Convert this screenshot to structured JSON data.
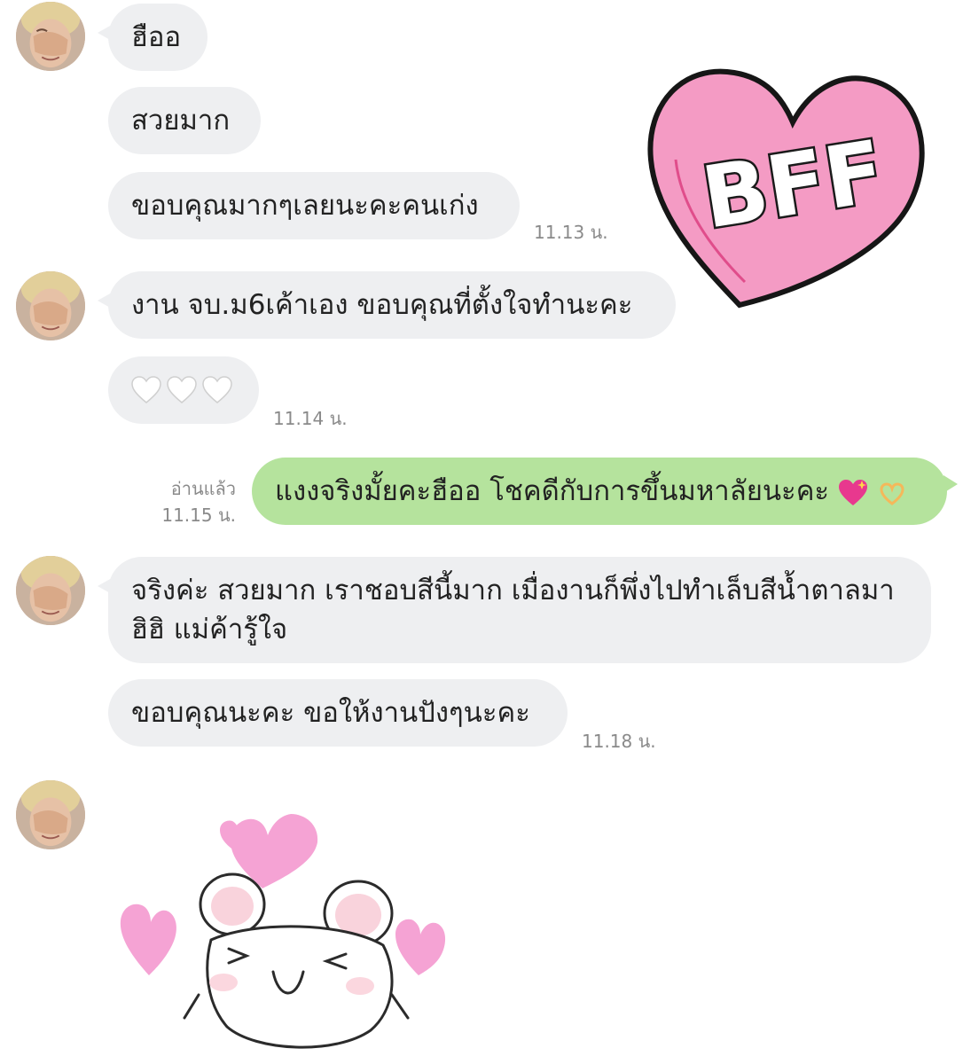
{
  "colors": {
    "received_bubble": "#eeeff1",
    "sent_bubble": "#b5e39d",
    "timestamp": "#8a8a8a",
    "sticker_pink": "#f07ab0",
    "text": "#222222"
  },
  "bff_sticker": {
    "text": "BFF",
    "icon": "pink-heart-bff-sticker"
  },
  "messages": [
    {
      "text": "ฮืออ"
    },
    {
      "text": "สวยมาก"
    },
    {
      "text": "ขอบคุณมากๆเลยนะคะคนเก่ง",
      "time": "11.13 น."
    },
    {
      "text": "งาน จบ.ม6เค้าเอง ขอบคุณที่ตั้งใจทำนะคะ"
    },
    {
      "icon": "white-heart-emoji",
      "count": 3,
      "time": "11.14 น."
    },
    {
      "text": "แงงจริงมั้ยคะฮืออ โชคดีกับการขึ้นมหาลัยนะคะ",
      "trailing_icons": [
        "sparkling-heart-emoji",
        "heart-hands-emoji"
      ],
      "read": "อ่านแล้ว",
      "time": "11.15 น."
    },
    {
      "text": "จริงค่ะ สวยมาก เราชอบสีนี้มาก เมื่องานก็พึ่งไปทำเล็บสีน้ำตาลมา ฮิฮิ แม่ค้ารู้ใจ"
    },
    {
      "text": "ขอบคุณนะคะ ขอให้งานปังๆนะคะ",
      "time": "11.18 น."
    }
  ],
  "mouse_sticker": {
    "icon": "mouse-with-hearts-sticker"
  }
}
